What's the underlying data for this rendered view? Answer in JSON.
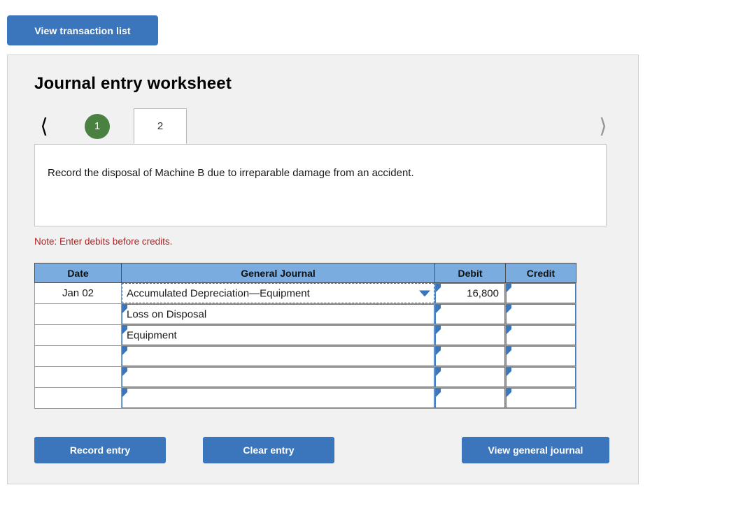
{
  "top": {
    "view_transaction_list_label": "View transaction list"
  },
  "panel": {
    "title": "Journal entry worksheet",
    "nav": {
      "prev_icon": "chevron-left-icon",
      "next_icon": "chevron-right-icon"
    },
    "tabs": [
      {
        "label": "1",
        "state": "completed"
      },
      {
        "label": "2",
        "state": "active"
      }
    ],
    "instruction": "Record the disposal of Machine B due to irreparable damage from an accident.",
    "note": "Note: Enter debits before credits."
  },
  "table": {
    "headers": [
      "Date",
      "General Journal",
      "Debit",
      "Credit"
    ],
    "rows": [
      {
        "date": "Jan 02",
        "account": "Accumulated Depreciation—Equipment",
        "debit": "16,800",
        "credit": "",
        "focused": true,
        "has_dropdown": true
      },
      {
        "date": "",
        "account": "Loss on Disposal",
        "debit": "",
        "credit": "",
        "focused": false,
        "has_dropdown": false
      },
      {
        "date": "",
        "account": "Equipment",
        "debit": "",
        "credit": "",
        "focused": false,
        "has_dropdown": false
      },
      {
        "date": "",
        "account": "",
        "debit": "",
        "credit": "",
        "focused": false,
        "has_dropdown": false
      },
      {
        "date": "",
        "account": "",
        "debit": "",
        "credit": "",
        "focused": false,
        "has_dropdown": false
      },
      {
        "date": "",
        "account": "",
        "debit": "",
        "credit": "",
        "focused": false,
        "has_dropdown": false
      }
    ]
  },
  "actions": {
    "record_entry_label": "Record entry",
    "clear_entry_label": "Clear entry",
    "view_general_journal_label": "View general journal"
  },
  "colors": {
    "brand_blue": "#3b76bc",
    "header_blue": "#7bacdf",
    "badge_green": "#4a8040",
    "note_red": "#b22222",
    "panel_bg": "#f1f1f1"
  }
}
